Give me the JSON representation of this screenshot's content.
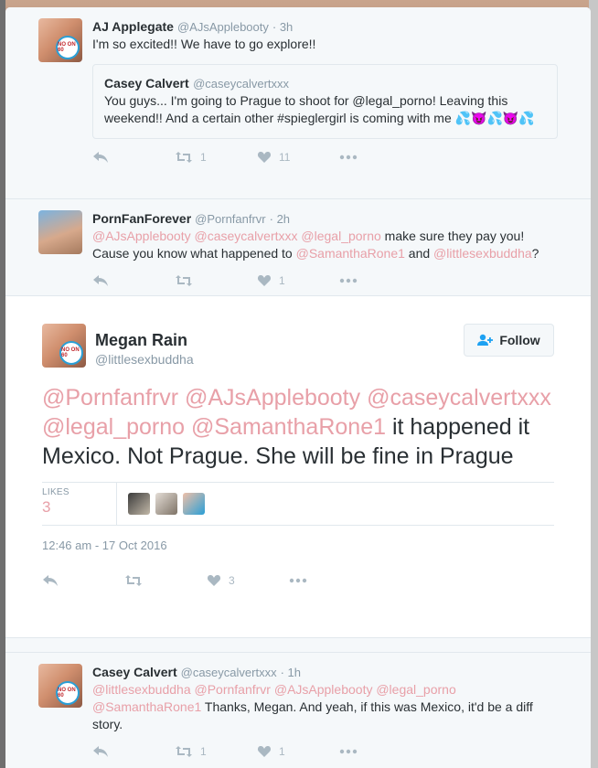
{
  "tweets": {
    "t1": {
      "name": "AJ Applegate",
      "handle": "@AJsApplebooty",
      "time": "· 3h",
      "text": "I'm so excited!! We have to go explore!!",
      "quote": {
        "name": "Casey Calvert",
        "handle": "@caseycalvertxxx",
        "text": "You guys... I'm going to Prague to shoot for @legal_porno! Leaving this weekend!! And a certain other #spieglergirl is coming with me 💦😈💦😈💦"
      },
      "retweets": "1",
      "likes": "11"
    },
    "t2": {
      "name": "PornFanForever",
      "handle": "@Pornfanfrvr",
      "time": "· 2h",
      "mentions": "@AJsApplebooty @caseycalvertxxx @legal_porno",
      "text1": " make sure they pay you! Cause you know what happened to ",
      "mention2": "@SamanthaRone1",
      "text2": " and ",
      "mention3": "@littlesexbuddha",
      "text3": "?",
      "likes": "1"
    },
    "main": {
      "name": "Megan Rain",
      "handle": "@littlesexbuddha",
      "follow_label": "Follow",
      "mentions": "@Pornfanfrvr @AJsApplebooty @caseycalvertxxx @legal_porno @SamanthaRone1",
      "text": " it happened it Mexico. Not Prague. She will be fine in Prague",
      "likes_label": "LIKES",
      "likes_count": "3",
      "timestamp": "12:46 am - 17 Oct 2016",
      "likes": "3"
    },
    "t3": {
      "name": "Casey Calvert",
      "handle": "@caseycalvertxxx",
      "time": "· 1h",
      "mentions": "@littlesexbuddha @Pornfanfrvr @AJsApplebooty @legal_porno @SamanthaRone1",
      "text": " Thanks, Megan. And yeah, if this was Mexico, it'd be a diff story.",
      "retweets": "1",
      "likes": "1"
    }
  },
  "badge_text": "NO ON 60",
  "colors": {
    "mention": "#e8a0a8",
    "muted": "#8899a6",
    "icon": "#aab8c2"
  },
  "icons": [
    "reply-icon",
    "retweet-icon",
    "heart-icon",
    "more-icon",
    "follow-user-icon"
  ]
}
